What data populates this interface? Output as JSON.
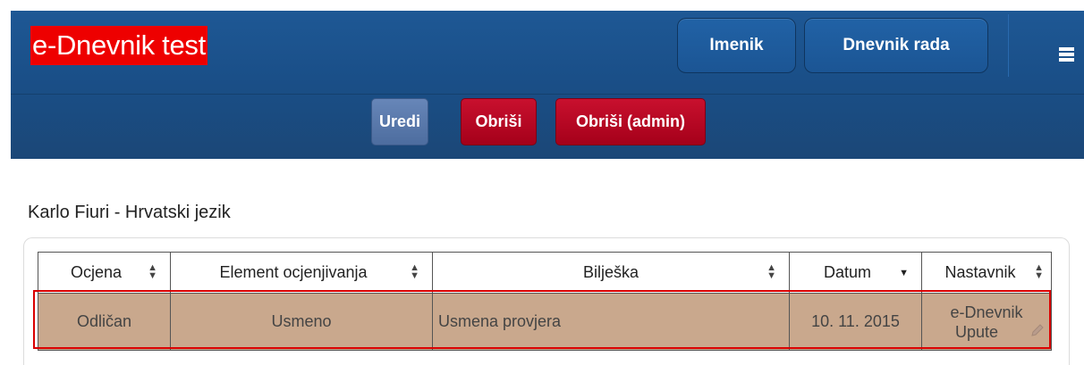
{
  "header": {
    "brand": "e-Dnevnik test",
    "nav": [
      "Imenik",
      "Dnevnik rada"
    ],
    "menu_icon": "hamburger-icon"
  },
  "actions": {
    "edit": "Uredi",
    "delete": "Obriši",
    "delete_admin": "Obriši (admin)"
  },
  "title": "Karlo Fiuri - Hrvatski jezik",
  "table": {
    "columns": [
      "Ocjena",
      "Element ocjenjivanja",
      "Bilješka",
      "Datum",
      "Nastavnik"
    ],
    "row": {
      "ocjena": "Odličan",
      "element": "Usmeno",
      "biljeska": "Usmena provjera",
      "datum": "10. 11. 2015",
      "nastavnik_line1": "e-Dnevnik",
      "nastavnik_line2": "Upute"
    }
  },
  "colors": {
    "header": "#1b4f88",
    "delete": "#b50021",
    "edit": "#5577aa",
    "row_highlight": "#c9a88d",
    "selection": "#d90000"
  }
}
